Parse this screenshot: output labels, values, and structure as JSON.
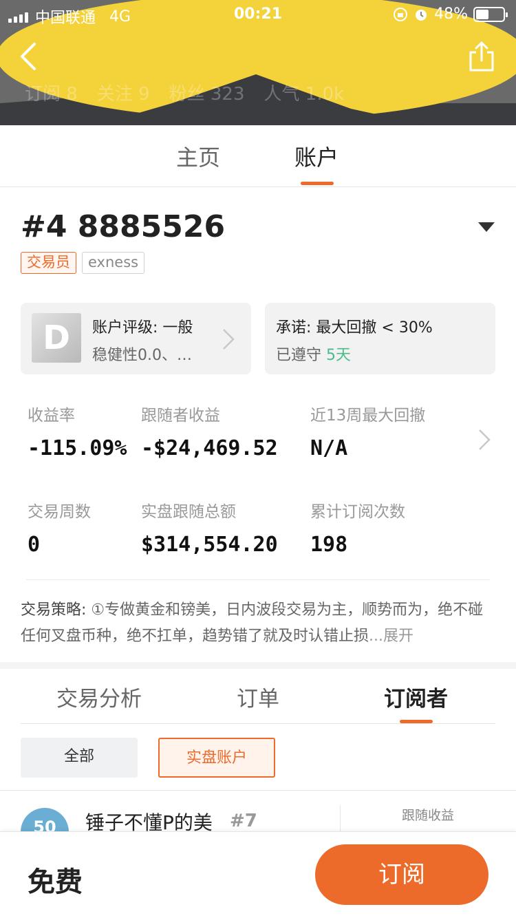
{
  "status_bar": {
    "carrier": "中国联通",
    "network": "4G",
    "time": "00:21",
    "battery": "48%",
    "battery_level": 0.48
  },
  "header": {
    "stats": [
      "订阅 8",
      "关注 9",
      "粉丝 323",
      "人气 1.0k"
    ],
    "banner_colors": {
      "yellow": "#f4d23a",
      "gray": "#6a6a6a",
      "dark": "#3a3c40"
    }
  },
  "main_tabs": [
    {
      "label": "主页",
      "active": false
    },
    {
      "label": "账户",
      "active": true
    }
  ],
  "account": {
    "number": "#4 8885526",
    "tags": [
      "交易员",
      "exness"
    ],
    "rating": {
      "grade": "D",
      "title": "账户评级: 一般",
      "subtitle": "稳健性0.0、…"
    },
    "promise": {
      "title": "承诺: 最大回撤 < 30%",
      "status_prefix": "已遵守 ",
      "status_days": "5天"
    }
  },
  "stats": [
    {
      "label": "收益率",
      "value": "-115.09%"
    },
    {
      "label": "跟随者收益",
      "value": "-$24,469.52"
    },
    {
      "label": "近13周最大回撤",
      "value": "N/A"
    },
    {
      "label": "交易周数",
      "value": "0"
    },
    {
      "label": "实盘跟随总额",
      "value": "$314,554.20"
    },
    {
      "label": "累计订阅次数",
      "value": "198"
    }
  ],
  "strategy": {
    "label": "交易策略:",
    "text": " ①专做黄金和镑美，日内波段交易为主，顺势而为，绝不碰任何叉盘币种，绝不扛单，趋势错了就及时认错止损",
    "more": "...展开"
  },
  "sub_tabs": [
    {
      "label": "交易分析",
      "active": false
    },
    {
      "label": "订单",
      "active": false
    },
    {
      "label": "订阅者",
      "active": true
    }
  ],
  "filters": [
    {
      "label": "全部",
      "active": false
    },
    {
      "label": "实盘账户",
      "active": true
    }
  ],
  "subscribers": [
    {
      "avatar_text": "50",
      "name": "锤子不懂P的美",
      "rank": "#7",
      "column_label": "跟随收益"
    }
  ],
  "bottom_bar": {
    "price": "免费",
    "subscribe_label": "订阅"
  },
  "colors": {
    "accent": "#ee6a2b",
    "green": "#4cbb8a",
    "card_bg": "#f2f2f2"
  }
}
